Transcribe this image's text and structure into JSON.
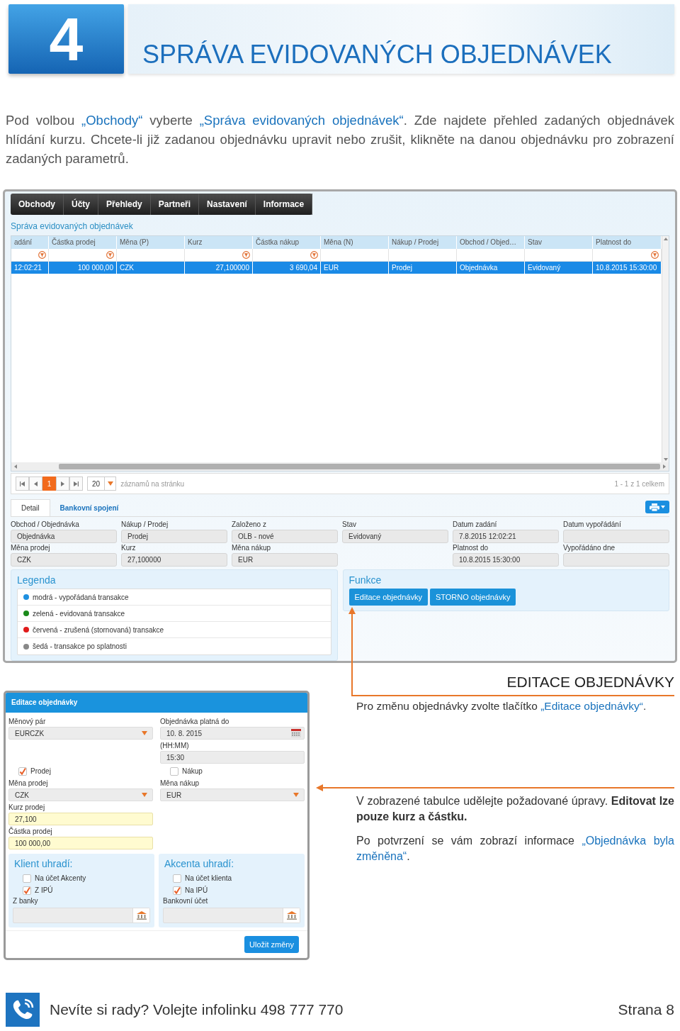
{
  "chapter": {
    "number": "4",
    "title": "SPRÁVA EVIDOVANÝCH OBJEDNÁVEK"
  },
  "intro": [
    {
      "kind": "plain",
      "text": "Pod volbou "
    },
    {
      "kind": "highlight",
      "text": "„Obchody“"
    },
    {
      "kind": "plain",
      "text": " vyberte "
    },
    {
      "kind": "highlight",
      "text": "„Správa evidovaných objednávek“"
    },
    {
      "kind": "plain",
      "text": ". Zde najdete přehled zadaných objednávek hlídání kurzu. Chcete-li již zadanou objednávku upravit nebo zrušit, klikněte na danou objednávku pro zobrazení zadaných parametrů."
    }
  ],
  "screen": {
    "menu": [
      "Obchody",
      "Účty",
      "Přehledy",
      "Partneři",
      "Nastavení",
      "Informace"
    ],
    "page_title": "Správa evidovaných objednávek",
    "table": {
      "columns": [
        {
          "label": "adání",
          "kind": "text",
          "filter": true
        },
        {
          "label": "Částka prodej",
          "kind": "number",
          "filter": true
        },
        {
          "label": "Měna (P)",
          "kind": "text",
          "filter": false
        },
        {
          "label": "Kurz",
          "kind": "number",
          "filter": true
        },
        {
          "label": "Částka nákup",
          "kind": "number",
          "filter": true
        },
        {
          "label": "Měna (N)",
          "kind": "text",
          "filter": false
        },
        {
          "label": "Nákup / Prodej",
          "kind": "text",
          "filter": false
        },
        {
          "label": "Obchod / Objed…",
          "kind": "text",
          "filter": false
        },
        {
          "label": "Stav",
          "kind": "text",
          "filter": false
        },
        {
          "label": "Platnost do",
          "kind": "text",
          "filter": true
        }
      ],
      "rows": [
        {
          "selected": true,
          "cells": [
            "12:02:21",
            "100 000,00",
            "CZK",
            "27,100000",
            "3 690,04",
            "EUR",
            "Prodej",
            "Objednávka",
            "Evidovaný",
            "10.8.2015 15:30:00"
          ]
        }
      ]
    },
    "pager": {
      "pages": [
        {
          "label": "1",
          "selected": true
        }
      ],
      "page_size": "20",
      "page_size_label": "záznamů na stránku",
      "summary": "1 - 1 z 1 celkem"
    },
    "tabs": [
      {
        "label": "Detail",
        "selected": true
      },
      {
        "label": "Bankovní spojení",
        "selected": false
      }
    ],
    "detail": [
      [
        {
          "kind": "field",
          "label": "Obchod / Objednávka",
          "value": "Objednávka"
        },
        {
          "kind": "field",
          "label": "Nákup / Prodej",
          "value": "Prodej"
        },
        {
          "kind": "field",
          "label": "Založeno z",
          "value": "OLB - nové"
        },
        {
          "kind": "field",
          "label": "Stav",
          "value": "Evidovaný"
        },
        {
          "kind": "field",
          "label": "Datum zadání",
          "value": "7.8.2015 12:02:21"
        },
        {
          "kind": "field",
          "label": "Datum vypořádání"
        }
      ],
      [
        {
          "kind": "field",
          "label": "Měna prodej",
          "value": "CZK"
        },
        {
          "kind": "field",
          "label": "Kurz",
          "value": "27,100000"
        },
        {
          "kind": "field",
          "label": "Měna nákup",
          "value": "EUR"
        },
        {
          "kind": "blank"
        },
        {
          "kind": "field",
          "label": "Platnost do",
          "value": "10.8.2015 15:30:00"
        },
        {
          "kind": "field",
          "label": "Vypořádáno dne"
        }
      ]
    ],
    "legend": {
      "title": "Legenda",
      "items": [
        {
          "label": "modrá - vypořádaná transakce",
          "color": "#1e90e0"
        },
        {
          "label": "zelená - evidovaná transakce",
          "color": "#1a8a1a"
        },
        {
          "label": "červená - zrušená (stornovaná) transakce",
          "color": "#e01b1b"
        },
        {
          "label": "šedá - transakce po splatnosti",
          "color": "#888888"
        }
      ]
    },
    "functions": {
      "title": "Funkce",
      "buttons": [
        "Editace objednávky",
        "STORNO objednávky"
      ]
    }
  },
  "annotation": {
    "heading": "EDITACE OBJEDNÁVKY",
    "hint": [
      {
        "kind": "plain",
        "text": "Pro změnu objednávky zvolte tlačítko "
      },
      {
        "kind": "highlight",
        "text": "„Editace objednávky“"
      },
      {
        "kind": "plain",
        "text": "."
      }
    ],
    "paragraphs": [
      [
        {
          "kind": "plain",
          "text": "V zobrazené tabulce udělejte požadované úpravy. **Editovat lze pouze kurz a částku.**"
        }
      ],
      [
        {
          "kind": "plain",
          "text": "Po potvrzení se vám zobrazí informace "
        },
        {
          "kind": "highlight",
          "text": "„Objednávka byla změněna“"
        },
        {
          "kind": "plain",
          "text": "."
        }
      ]
    ]
  },
  "dialog": {
    "title": "Editace objednávky",
    "rows": [
      [
        {
          "kind": "select",
          "label": "Měnový pár",
          "value": "EURCZK"
        },
        {
          "kind": "date",
          "label": "Objednávka platná do",
          "value": "10. 8. 2015"
        }
      ],
      [
        {
          "kind": "blank"
        },
        {
          "kind": "input",
          "label": "(HH:MM)",
          "value": "15:30"
        }
      ],
      [
        {
          "kind": "checkbox",
          "label": "Prodej",
          "checked": true
        },
        {
          "kind": "checkbox",
          "label": "Nákup",
          "checked": false
        }
      ],
      [
        {
          "kind": "select",
          "label": "Měna prodej",
          "value": "CZK"
        },
        {
          "kind": "select",
          "label": "Měna nákup",
          "value": "EUR"
        }
      ],
      [
        {
          "kind": "editable",
          "label": "Kurz prodej",
          "value": "27,100"
        },
        {
          "kind": "blank"
        }
      ],
      [
        {
          "kind": "editable",
          "label": "Částka prodej",
          "value": "100 000,00"
        },
        {
          "kind": "blank"
        }
      ]
    ],
    "payment_panels": [
      {
        "title": "Klient uhradí:",
        "options": [
          {
            "label": "Na účet Akcenty",
            "checked": false
          },
          {
            "label": "Z IPÚ",
            "checked": true
          }
        ],
        "field_label": "Z banky"
      },
      {
        "title": "Akcenta uhradí:",
        "options": [
          {
            "label": "Na účet klienta",
            "checked": false
          },
          {
            "label": "Na IPÚ",
            "checked": true
          }
        ],
        "field_label": "Bankovní účet"
      }
    ],
    "save_button": "Uložit změny"
  },
  "footer": {
    "helpline": "Nevíte si rady? Volejte infolinku 498 777 770",
    "page": "Strana 8"
  }
}
